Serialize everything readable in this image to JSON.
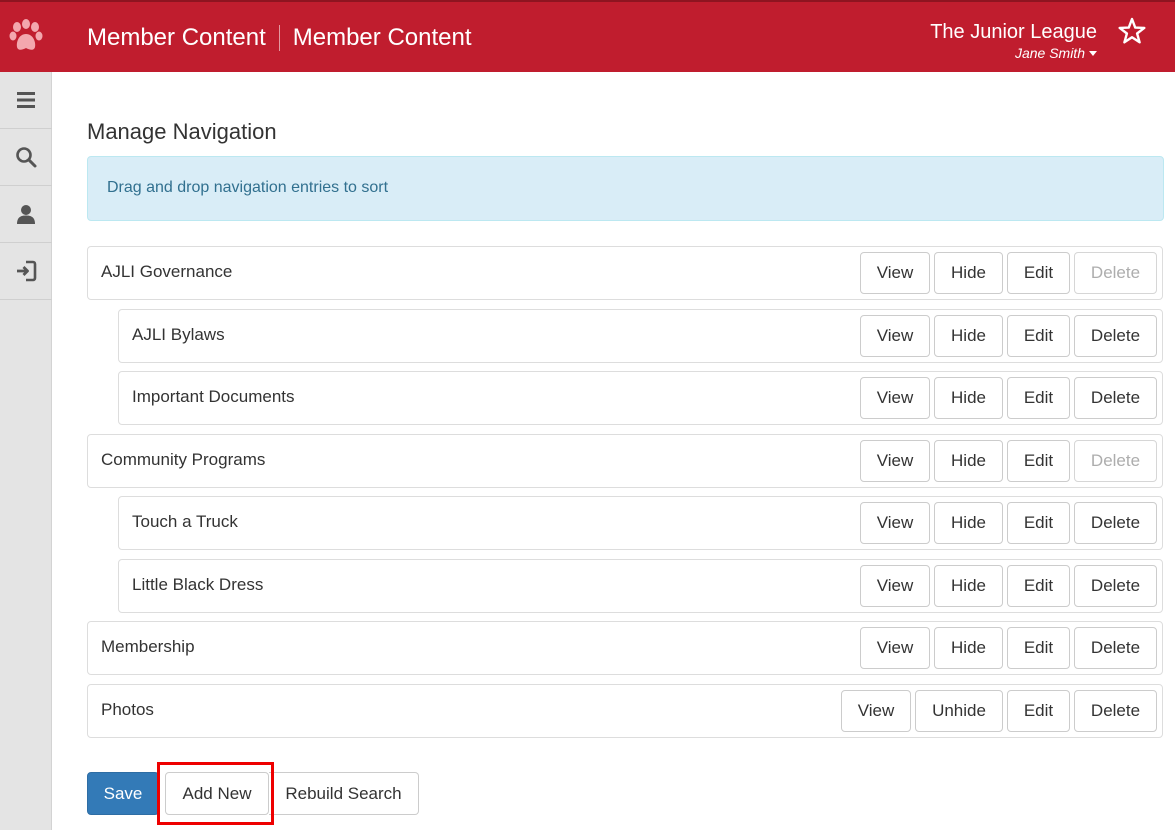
{
  "header": {
    "section_title": "Member Content",
    "page_title": "Member Content",
    "org_name": "The Junior League",
    "user_name": "Jane Smith",
    "icons": {
      "logo": "paw-icon",
      "favorite": "star-icon",
      "user_menu": "caret-down-icon"
    }
  },
  "sidebar": {
    "items": [
      {
        "icon": "menu-icon"
      },
      {
        "icon": "search-icon"
      },
      {
        "icon": "user-icon"
      },
      {
        "icon": "sign-in-icon"
      }
    ]
  },
  "main": {
    "title": "Manage Navigation",
    "info": "Drag and drop navigation entries to sort",
    "buttons": {
      "view": "View",
      "hide": "Hide",
      "unhide": "Unhide",
      "edit": "Edit",
      "delete": "Delete"
    },
    "entries": [
      {
        "label": "AJLI Governance",
        "level": 0,
        "hidden": false,
        "delete_enabled": false
      },
      {
        "label": "AJLI Bylaws",
        "level": 1,
        "hidden": false,
        "delete_enabled": true
      },
      {
        "label": "Important Documents",
        "level": 1,
        "hidden": false,
        "delete_enabled": true
      },
      {
        "label": "Community Programs",
        "level": 0,
        "hidden": false,
        "delete_enabled": false
      },
      {
        "label": "Touch a Truck",
        "level": 1,
        "hidden": false,
        "delete_enabled": true
      },
      {
        "label": "Little Black Dress",
        "level": 1,
        "hidden": false,
        "delete_enabled": true
      },
      {
        "label": "Membership",
        "level": 0,
        "hidden": false,
        "delete_enabled": true
      },
      {
        "label": "Photos",
        "level": 0,
        "hidden": true,
        "delete_enabled": true
      }
    ]
  },
  "footer": {
    "save": "Save",
    "add_new": "Add New",
    "rebuild_search": "Rebuild Search"
  },
  "colors": {
    "brand": "#c01d2e",
    "primary": "#337ab7",
    "info_bg": "#d9edf7",
    "info_text": "#31708f",
    "annotation": "#ee0000"
  }
}
